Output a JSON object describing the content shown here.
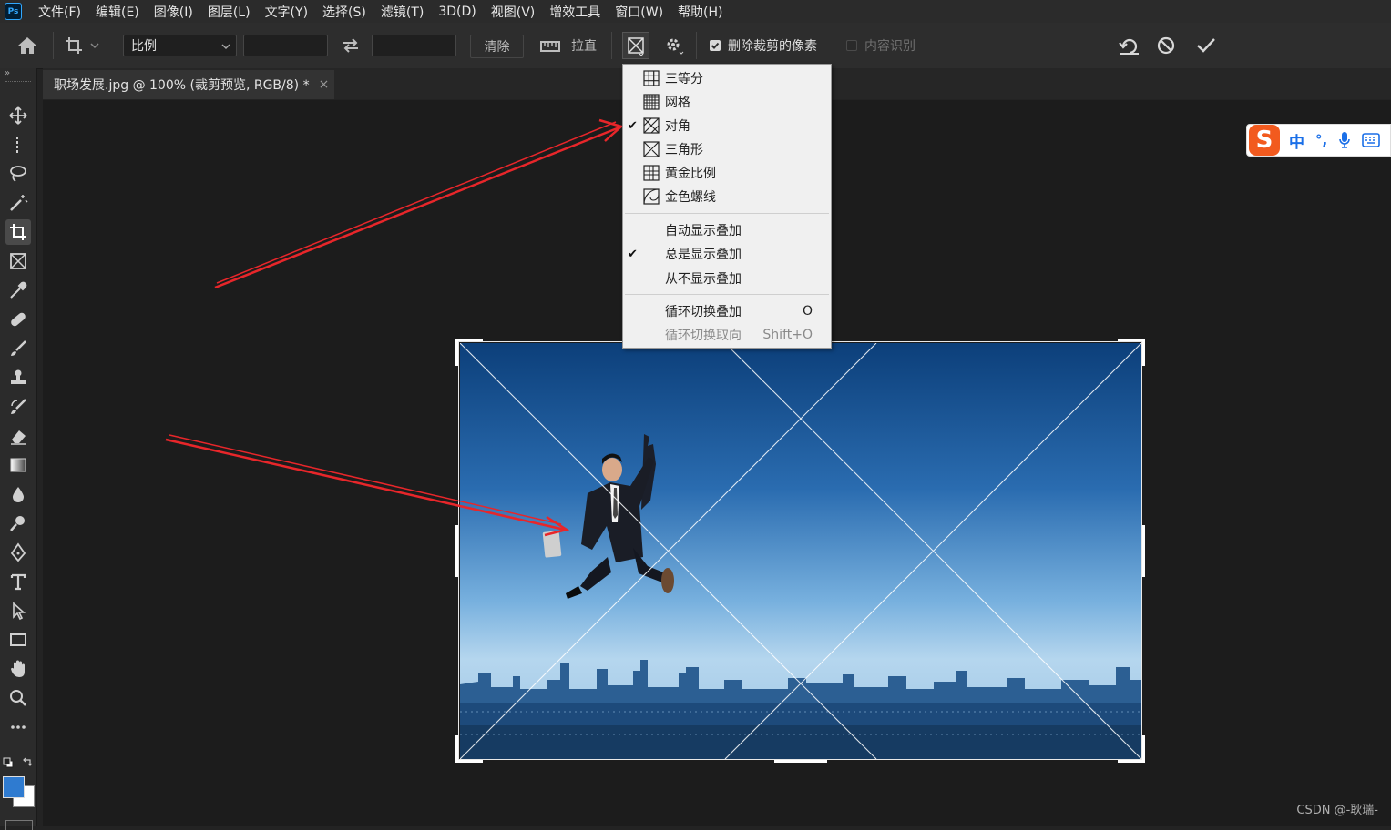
{
  "app": {
    "logo": "Ps"
  },
  "menubar": [
    "文件(F)",
    "编辑(E)",
    "图像(I)",
    "图层(L)",
    "文字(Y)",
    "选择(S)",
    "滤镜(T)",
    "3D(D)",
    "视图(V)",
    "增效工具",
    "窗口(W)",
    "帮助(H)"
  ],
  "options": {
    "ratio_select": "比例",
    "width_value": "",
    "height_value": "",
    "clear_label": "清除",
    "straighten_label": "拉直",
    "delete_cropped_label": "删除裁剪的像素",
    "delete_cropped_checked": true,
    "content_aware_label": "内容识别",
    "content_aware_checked": false
  },
  "document_tab": {
    "title": "职场发展.jpg @ 100% (裁剪预览, RGB/8) *",
    "close": "×"
  },
  "overlay_menu": {
    "overlays": [
      {
        "label": "三等分",
        "icon": "rule-of-thirds-icon",
        "checked": false
      },
      {
        "label": "网格",
        "icon": "grid-icon",
        "checked": false
      },
      {
        "label": "对角",
        "icon": "diagonal-icon",
        "checked": true
      },
      {
        "label": "三角形",
        "icon": "triangle-icon",
        "checked": false
      },
      {
        "label": "黄金比例",
        "icon": "golden-ratio-icon",
        "checked": false
      },
      {
        "label": "金色螺线",
        "icon": "golden-spiral-icon",
        "checked": false
      }
    ],
    "display": [
      {
        "label": "自动显示叠加",
        "checked": false
      },
      {
        "label": "总是显示叠加",
        "checked": true
      },
      {
        "label": "从不显示叠加",
        "checked": false
      }
    ],
    "cycle": [
      {
        "label": "循环切换叠加",
        "shortcut": "O",
        "disabled": false
      },
      {
        "label": "循环切换取向",
        "shortcut": "Shift+O",
        "disabled": true
      }
    ]
  },
  "ime": {
    "mode": "中",
    "punct": "°,"
  },
  "watermark": "CSDN @-耿瑞-",
  "colors": {
    "accent": "#e8262a",
    "foreground_swatch": "#2f7bd0",
    "background_swatch": "#ffffff"
  }
}
